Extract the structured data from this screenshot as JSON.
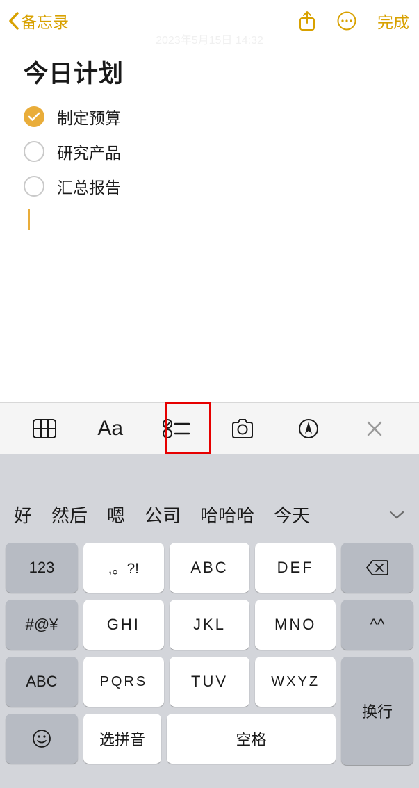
{
  "nav": {
    "back_label": "备忘录",
    "done_label": "完成",
    "timestamp": "2023年5月15日 14:32"
  },
  "note": {
    "title": "今日计划",
    "items": [
      {
        "label": "制定预算",
        "checked": true
      },
      {
        "label": "研究产品",
        "checked": false
      },
      {
        "label": "汇总报告",
        "checked": false
      }
    ]
  },
  "toolbar": {
    "aa_label": "Aa"
  },
  "keyboard": {
    "suggestions": [
      "好",
      "然后",
      "嗯",
      "公司",
      "哈哈哈",
      "今天"
    ],
    "keys": {
      "num": "123",
      "sym": "#@¥",
      "abc": "ABC",
      "punct": ",。?!",
      "r1c1": "ABC",
      "r1c2": "DEF",
      "r2c0": "GHI",
      "r2c1": "JKL",
      "r2c2": "MNO",
      "r3c0": "PQRS",
      "r3c1": "TUV",
      "r3c2": "WXYZ",
      "pinyin": "选拼音",
      "space": "空格",
      "face": "^^",
      "enter": "换行"
    }
  }
}
